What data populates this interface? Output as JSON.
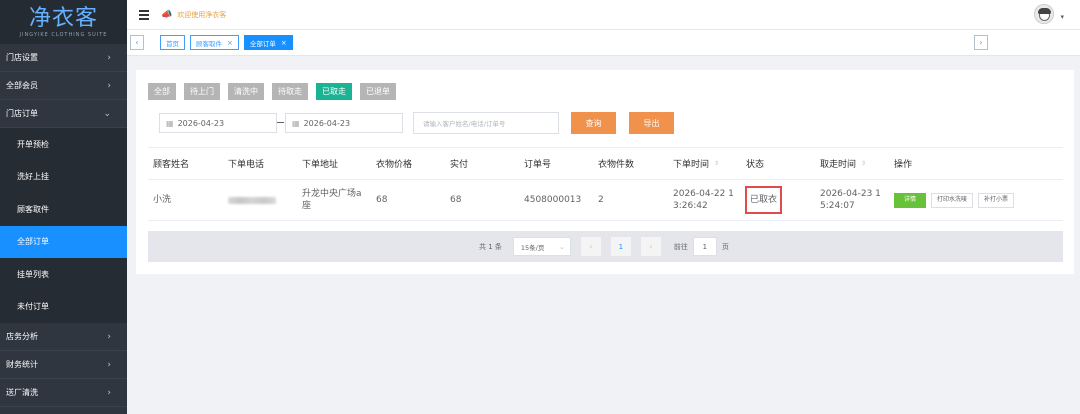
{
  "sidebar": {
    "logo": "净衣客",
    "logo_sub": "JINGYIKE CLOTHING SUITE",
    "menu_top": [
      {
        "label": "门店设置",
        "chev": "›"
      },
      {
        "label": "全部会员",
        "chev": "›"
      },
      {
        "label": "门店订单",
        "chev": "⌄"
      }
    ],
    "sub_items": [
      "开单预检",
      "洗好上挂",
      "顾客取件",
      "全部订单",
      "挂单列表",
      "未付订单"
    ],
    "menu_bottom": [
      {
        "label": "店务分析",
        "chev": "›"
      },
      {
        "label": "财务统计",
        "chev": "›"
      },
      {
        "label": "送厂清洗",
        "chev": "›"
      }
    ]
  },
  "header": {
    "announcement": "欢迎使用净衣客"
  },
  "tabs": [
    {
      "label": "首页",
      "close": ""
    },
    {
      "label": "顾客取件",
      "close": "×"
    },
    {
      "label": "全部订单",
      "close": "×"
    }
  ],
  "scroll": {
    "left": "‹",
    "right": "›"
  },
  "filters": [
    "全部",
    "待上门",
    "清洗中",
    "待取走",
    "已取走",
    "已退单"
  ],
  "search": {
    "start_date": "2026-04-23",
    "end_date": "2026-04-23",
    "placeholder": "请输入客户姓名/电话/订单号",
    "query_label": "查询",
    "export_label": "导出"
  },
  "table": {
    "headers": [
      "顾客姓名",
      "下单电话",
      "下单地址",
      "衣物价格",
      "实付",
      "订单号",
      "衣物件数",
      "下单时间",
      "状态",
      "取走时间",
      "操作"
    ],
    "sort_glyph": "⇕",
    "row": {
      "name": "小洗",
      "address": "升龙中央广场a座",
      "price": "68",
      "paid": "68",
      "order_no": "4508000013",
      "count": "2",
      "order_time": "2026-04-22 13:26:42",
      "status": "已取衣",
      "pickup_time": "2026-04-23 15:24:07",
      "actions": [
        "详情",
        "打印水洗唛",
        "补打小票"
      ]
    }
  },
  "pagination": {
    "total": "共 1 条",
    "page_size": "15条/页",
    "current": "1",
    "goto_label": "前往",
    "goto_value": "1",
    "page_suffix": "页"
  },
  "colors": {
    "sidebar_bg": "#2f3640",
    "active_blue": "#1890ff",
    "filter_active": "#1ab394",
    "action_orange": "#f0924c",
    "status_highlight": "#e04c4c"
  }
}
